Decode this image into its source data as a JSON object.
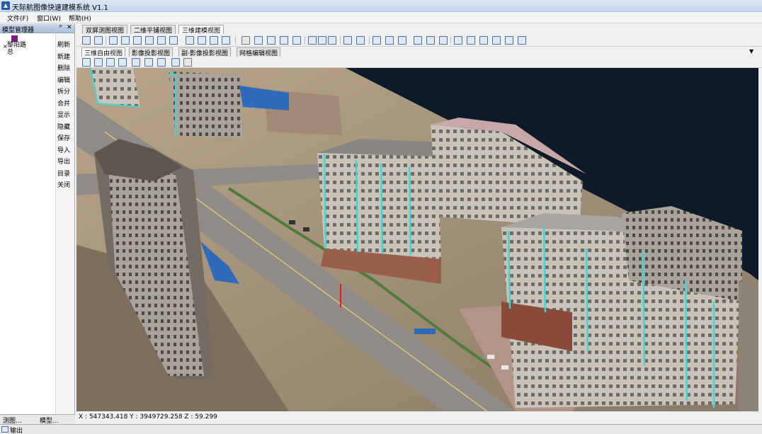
{
  "app": {
    "title": "天际航图像快速建模系统 V1.1"
  },
  "menu": [
    {
      "label": "文件(F)"
    },
    {
      "label": "窗口(W)"
    },
    {
      "label": "帮助(H)"
    }
  ],
  "left_panel": {
    "title": "模型管理器",
    "pin": "ᵖ",
    "close": "✕",
    "tree": {
      "expander": "×",
      "name": "黎阳路总",
      "swatch_color": "#7a1d7a"
    },
    "commands": [
      "刷新",
      "新建",
      "删除",
      "编辑",
      "拆分",
      "合并",
      "显示",
      "隐藏",
      "保存",
      "导入",
      "导出",
      "目录",
      "关闭"
    ]
  },
  "view_tabs": [
    {
      "label": "双屏测图视图",
      "active": false
    },
    {
      "label": "二维平铺视图",
      "active": false
    },
    {
      "label": "三维建模视图",
      "active": true
    }
  ],
  "sub_tabs": [
    {
      "label": "三维自由视图",
      "active": true
    },
    {
      "label": "影像投影视图",
      "active": false
    },
    {
      "label": "副·影像投影视图",
      "active": false
    },
    {
      "label": "网格编辑视图",
      "active": false
    }
  ],
  "dropdown_icon": "▼",
  "status": {
    "coords": "X : 547343.418 Y : 3949729.258 Z : 59.299"
  },
  "bottom_tabs": [
    {
      "label": "测图..."
    },
    {
      "label": "模型..."
    }
  ],
  "output": {
    "label": "输出"
  },
  "colors": {
    "sky": "#0f1a28",
    "cyan_edges": "#3fd6d6",
    "ground": "#9a8a74"
  }
}
